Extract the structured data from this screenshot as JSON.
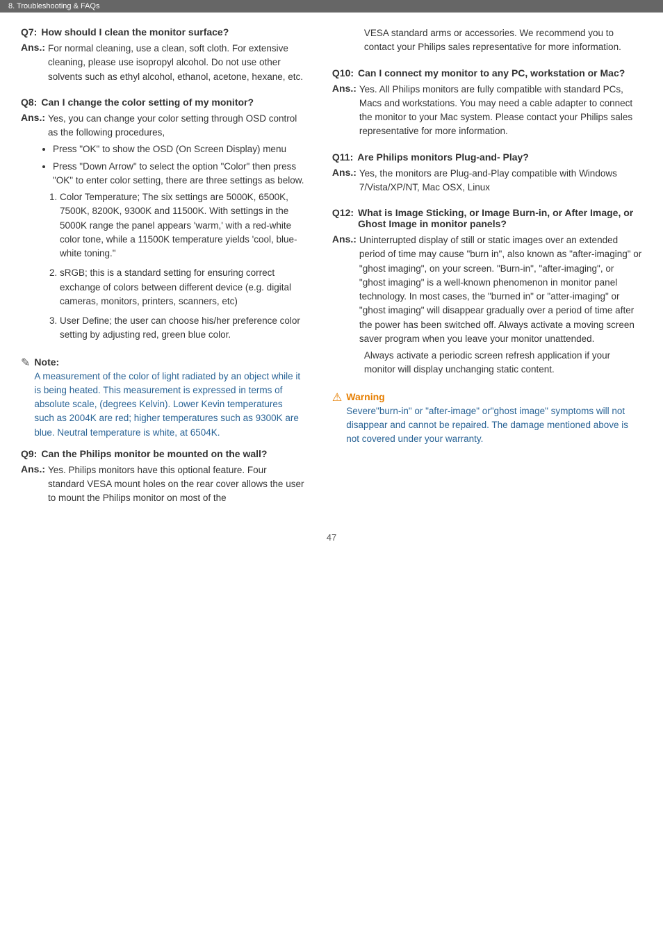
{
  "header": {
    "label": "8. Troubleshooting & FAQs"
  },
  "pageNumber": "47",
  "leftCol": {
    "q7": {
      "label": "Q7:",
      "question": "How should I clean the monitor surface?",
      "ansLabel": "Ans.:",
      "answer": "For normal cleaning, use a clean, soft cloth. For extensive cleaning, please use isopropyl alcohol. Do not use other solvents such as ethyl alcohol, ethanol, acetone, hexane, etc."
    },
    "q8": {
      "label": "Q8:",
      "question": "Can I change the color setting of my monitor?",
      "ansLabel": "Ans.:",
      "answerIntro": "Yes, you can change your color setting through OSD control as the following procedures,",
      "bullets": [
        "Press \"OK\" to show the OSD (On Screen Display) menu",
        "Press \"Down Arrow\" to select the option \"Color\" then press \"OK\" to enter color setting, there are three settings as below."
      ],
      "numbered": [
        "Color Temperature; The six settings are 5000K, 6500K, 7500K, 8200K, 9300K and 11500K. With settings in the 5000K range the panel appears 'warm,' with a red-white color tone, while a 11500K temperature yields 'cool, blue-white toning.\"",
        "sRGB; this is a standard setting for ensuring correct exchange of colors between different device (e.g. digital cameras, monitors, printers, scanners, etc)",
        "User Define; the user can choose his/her preference color setting by adjusting red, green blue color."
      ]
    },
    "note": {
      "title": "Note:",
      "text": "A measurement of the color of light radiated by an object while it is being heated. This measurement is expressed in terms of absolute scale, (degrees Kelvin). Lower Kevin temperatures such as 2004K are red; higher temperatures such as 9300K are blue. Neutral temperature is white, at 6504K."
    },
    "q9": {
      "label": "Q9:",
      "question": "Can the Philips monitor be mounted on the wall?",
      "ansLabel": "Ans.:",
      "answer": "Yes. Philips monitors have this optional feature. Four standard VESA mount holes on the rear cover allows the user to mount the Philips monitor on most of the"
    }
  },
  "rightCol": {
    "q9cont": {
      "text": "VESA standard arms or accessories. We recommend you to contact your Philips sales representative for more information."
    },
    "q10": {
      "label": "Q10:",
      "question": "Can I connect my monitor to any PC, workstation or Mac?",
      "ansLabel": "Ans.:",
      "answer": "Yes. All Philips monitors are fully compatible with standard PCs, Macs and workstations. You may need a cable adapter to connect the monitor to your Mac system. Please contact your Philips sales representative for more information."
    },
    "q11": {
      "label": "Q11:",
      "question": "Are Philips monitors Plug-and- Play?",
      "ansLabel": "Ans.:",
      "answer": "Yes, the monitors are Plug-and-Play compatible with Windows 7/Vista/XP/NT, Mac OSX, Linux"
    },
    "q12": {
      "label": "Q12:",
      "question": "What is Image Sticking, or Image Burn-in, or After Image, or Ghost Image in monitor panels?",
      "ansLabel": "Ans.:",
      "answer1": "Uninterrupted display of still or static images over an extended period of time may cause \"burn in\", also known as \"after-imaging\" or \"ghost imaging\", on your screen. \"Burn-in\", \"after-imaging\", or \"ghost imaging\" is a well-known phenomenon in monitor panel technology. In most cases, the \"burned in\" or \"atter-imaging\" or \"ghost imaging\" will disappear gradually over a period of time after the power has been switched off. Always activate a moving screen saver program when you leave your monitor unattended.",
      "answer2": "Always activate a periodic screen refresh application if your monitor will display unchanging static content."
    },
    "warning": {
      "title": "Warning",
      "text": "Severe\"burn-in\" or \"after-image\" or\"ghost image\" symptoms will not disappear and cannot be repaired. The damage mentioned above is not covered under your warranty."
    }
  }
}
